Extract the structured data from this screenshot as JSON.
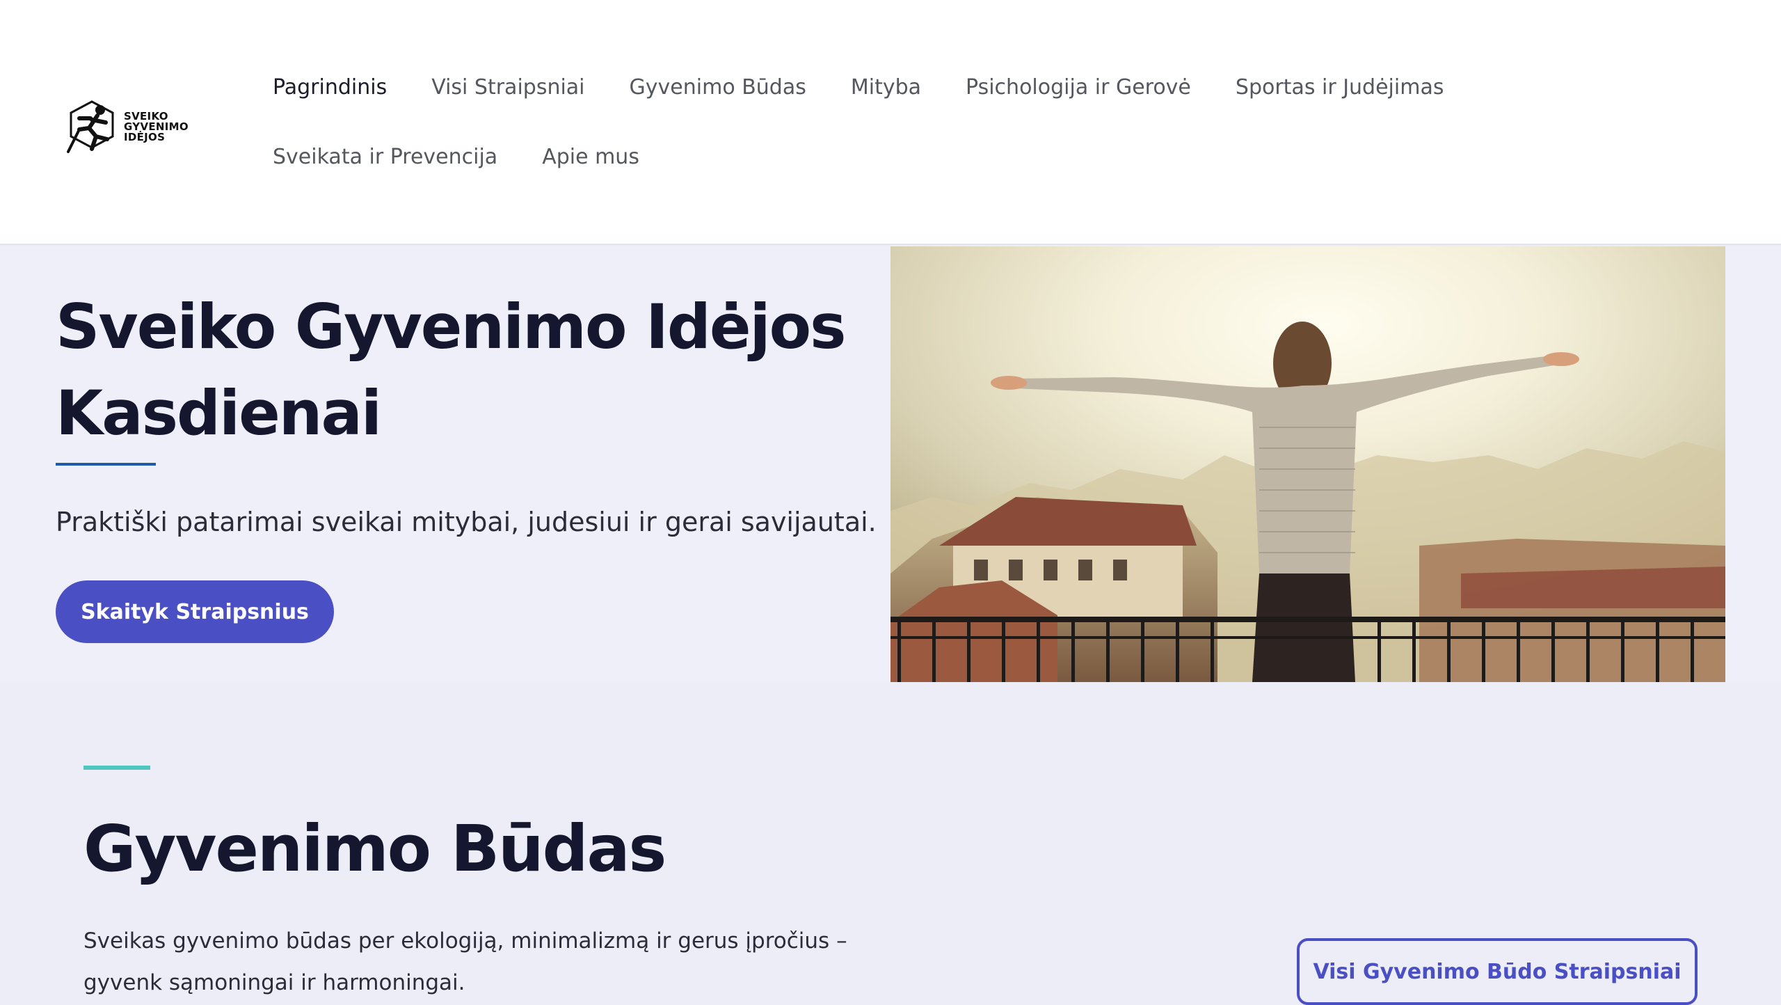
{
  "site": {
    "logo_text_lines": [
      "SVEIKO",
      "GYVENIMO",
      "IDĖJOS"
    ]
  },
  "nav": {
    "items": [
      {
        "label": "Pagrindinis",
        "active": true
      },
      {
        "label": "Visi Straipsniai"
      },
      {
        "label": "Gyvenimo Būdas"
      },
      {
        "label": "Mityba"
      },
      {
        "label": "Psichologija ir Gerovė"
      },
      {
        "label": "Sportas ir Judėjimas"
      },
      {
        "label": "Sveikata ir Prevencija"
      },
      {
        "label": "Apie mus"
      }
    ]
  },
  "hero": {
    "title_line1": "Sveiko Gyvenimo Idėjos",
    "title_line2": "Kasdienai",
    "subtitle": "Praktiški patarimai sveikai mitybai, judesiui ir gerai savijautai.",
    "cta_label": "Skaityk Straipsnius"
  },
  "section": {
    "title": "Gyvenimo Būdas",
    "description": "Sveikas gyvenimo būdas per ekologiją, minimalizmą ir gerus įpročius – gyvenk sąmoningai ir harmoningai.",
    "button_label": "Visi Gyvenimo Būdo Straipsniai"
  },
  "colors": {
    "accent": "#4b4fc4",
    "teal": "#4fc7c0",
    "rule_blue": "#1f5aa6",
    "heading": "#15172f"
  }
}
